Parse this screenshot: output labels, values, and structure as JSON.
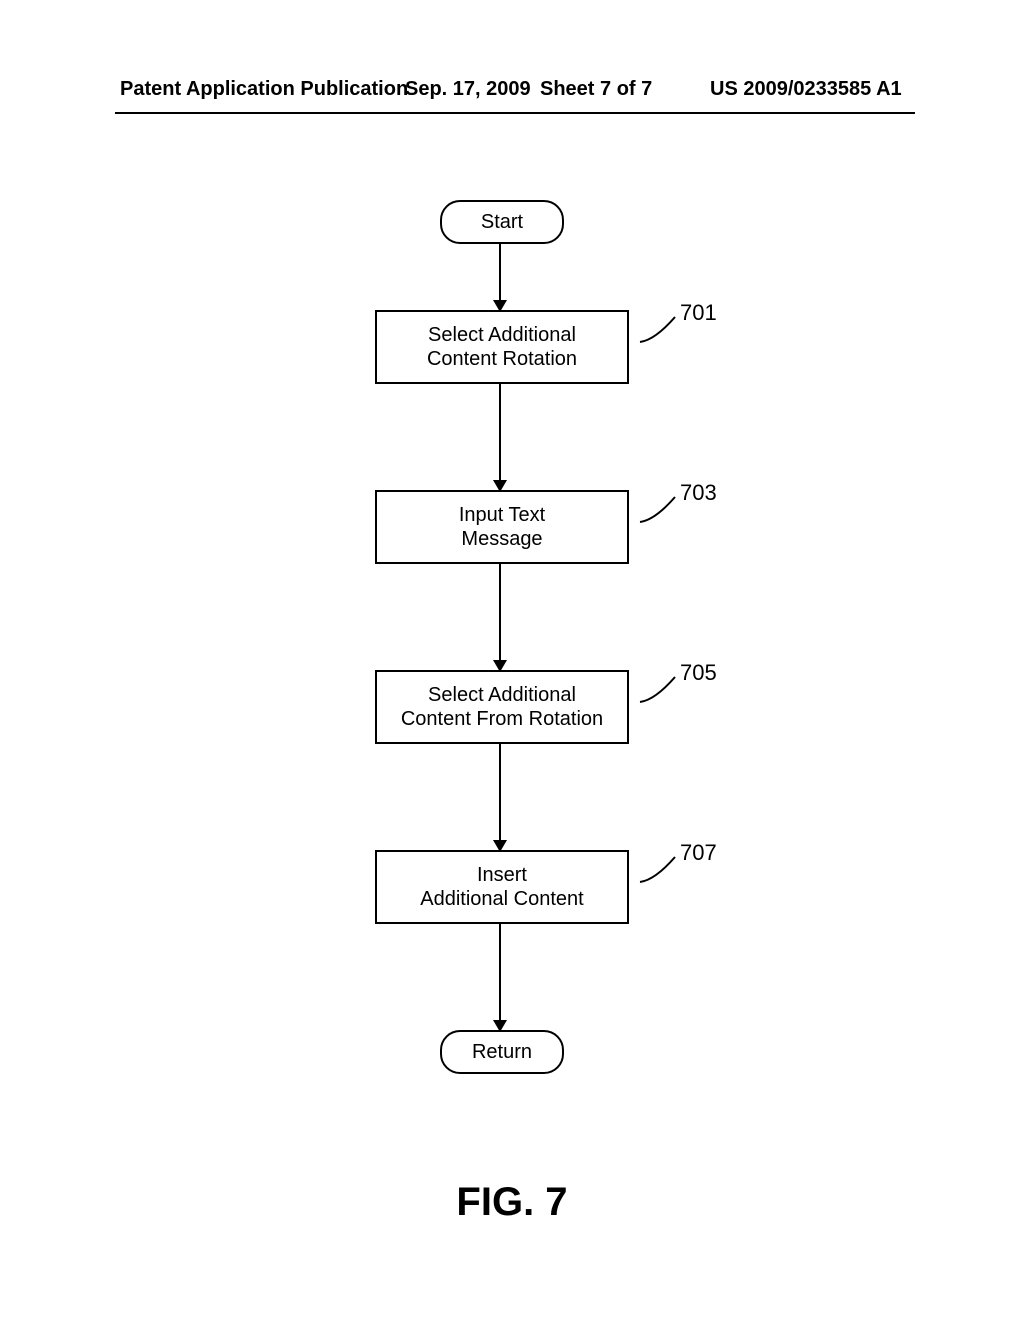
{
  "header": {
    "left": "Patent Application Publication",
    "date": "Sep. 17, 2009",
    "sheet": "Sheet 7 of 7",
    "pubno": "US 2009/0233585 A1"
  },
  "flow": {
    "start": "Start",
    "step1": "Select Additional\nContent Rotation",
    "step2": "Input Text\nMessage",
    "step3": "Select Additional\nContent From Rotation",
    "step4": "Insert\nAdditional Content",
    "return": "Return"
  },
  "refs": {
    "r1": "701",
    "r2": "703",
    "r3": "705",
    "r4": "707"
  },
  "caption": "FIG. 7"
}
